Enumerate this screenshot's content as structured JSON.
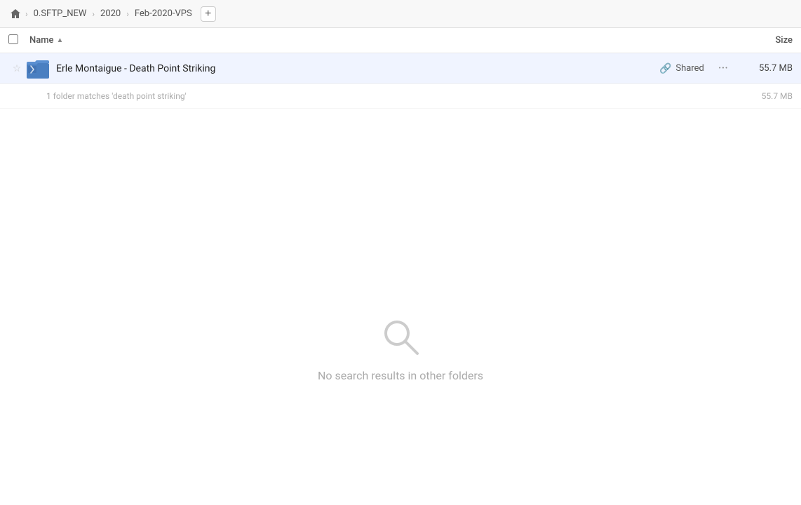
{
  "breadcrumb": {
    "home_icon": "🏠",
    "items": [
      {
        "label": "0.SFTP_NEW"
      },
      {
        "label": "2020"
      },
      {
        "label": "Feb-2020-VPS"
      }
    ],
    "add_button": "+"
  },
  "columns": {
    "name_label": "Name",
    "sort_indicator": "▲",
    "size_label": "Size"
  },
  "file_row": {
    "star_icon": "☆",
    "name": "Erle Montaigue - Death Point Striking",
    "shared_label": "Shared",
    "more_icon": "···",
    "size": "55.7 MB"
  },
  "match_info": {
    "text": "1 folder matches 'death point striking'",
    "size": "55.7 MB"
  },
  "empty_state": {
    "message": "No search results in other folders"
  },
  "colors": {
    "row_bg": "#f0f4ff",
    "folder_blue": "#4a7fc1",
    "folder_dark": "#3a6aaa"
  }
}
